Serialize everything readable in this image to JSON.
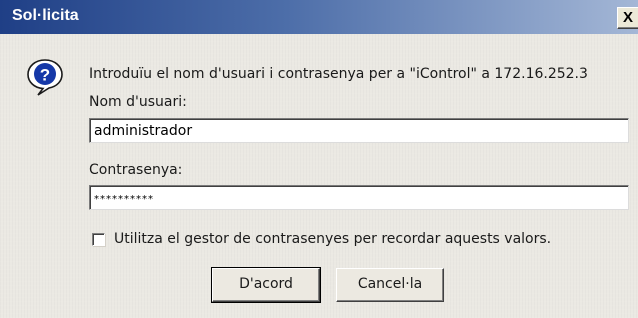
{
  "window": {
    "title": "Sol·licita",
    "close_label": "X"
  },
  "dialog": {
    "icon": "question-icon",
    "message": "Introduïu el nom d'usuari i contrasenya per a \"iControl\" a 172.16.252.3",
    "username_label": "Nom d'usuari:",
    "username_value": "administrador",
    "password_label": "Contrasenya:",
    "password_value": "**********",
    "remember_label": "Utilitza el gestor de contrasenyes per recordar aquests valors.",
    "remember_checked": false
  },
  "buttons": {
    "ok_label": "D'acord",
    "cancel_label": "Cancel·la"
  }
}
